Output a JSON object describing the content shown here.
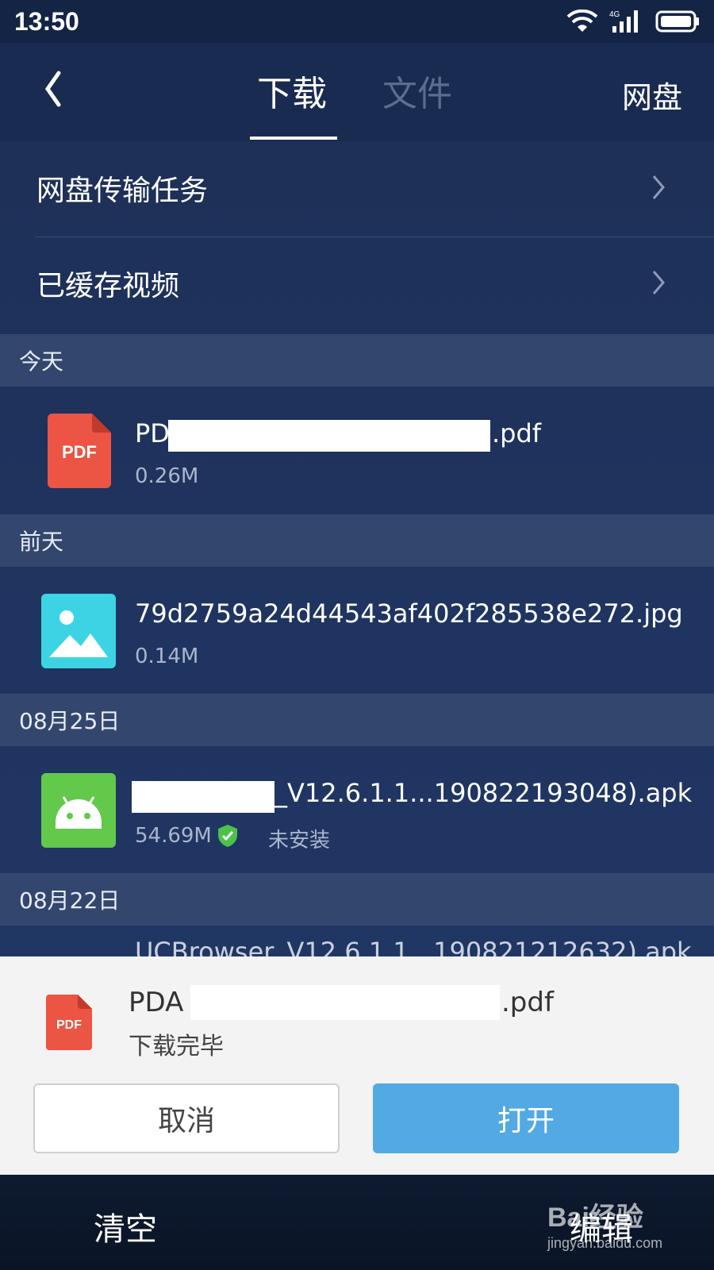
{
  "status_bar": {
    "time": "13:50",
    "network": "4G",
    "icons": [
      "wifi-icon",
      "cellular-signal-icon",
      "battery-icon"
    ]
  },
  "header": {
    "back_icon": "back-chevron-icon",
    "tabs": [
      {
        "label": "下载",
        "active": true
      },
      {
        "label": "文件",
        "active": false
      }
    ],
    "right_label": "网盘"
  },
  "menu": [
    {
      "label": "网盘传输任务",
      "icon": "chevron-right-icon"
    },
    {
      "label": "已缓存视频",
      "icon": "chevron-right-icon"
    }
  ],
  "sections": [
    {
      "title": "今天",
      "items": [
        {
          "icon": "pdf-icon",
          "icon_label": "PDF",
          "name_prefix": "PD",
          "name_suffix": ".pdf",
          "size": "0.26M"
        }
      ]
    },
    {
      "title": "前天",
      "items": [
        {
          "icon": "image-file-icon",
          "name": "79d2759a24d44543af402f285538e272.jpg",
          "size": "0.14M"
        }
      ]
    },
    {
      "title": "08月25日",
      "items": [
        {
          "icon": "android-apk-icon",
          "name_suffix": "_V12.6.1.1...190822193048).apk",
          "size": "54.69M",
          "badge_icon": "verified-shield-icon",
          "status": "未安装"
        }
      ]
    },
    {
      "title": "08月22日",
      "items": [
        {
          "icon": "android-apk-icon",
          "name": "UCBrowser_V12.6.1.1...190821212632).apk"
        }
      ]
    }
  ],
  "dialog": {
    "icon": "pdf-icon",
    "icon_label": "PDF",
    "title_prefix": "PDA",
    "title_suffix": ".pdf",
    "subtitle": "下载完毕",
    "cancel_label": "取消",
    "open_label": "打开"
  },
  "bottom_bar": {
    "clear_label": "清空",
    "edit_label": "编辑"
  },
  "watermark": {
    "main": "Bai经验",
    "sub": "jingyan.baidu.com"
  },
  "colors": {
    "background": "#1f3460",
    "section_header": "#33476e",
    "pdf_red": "#ec5443",
    "image_cyan": "#3cd4e4",
    "android_green": "#63c94a",
    "open_button": "#52a9e3",
    "verified_green": "#4cc24a"
  }
}
